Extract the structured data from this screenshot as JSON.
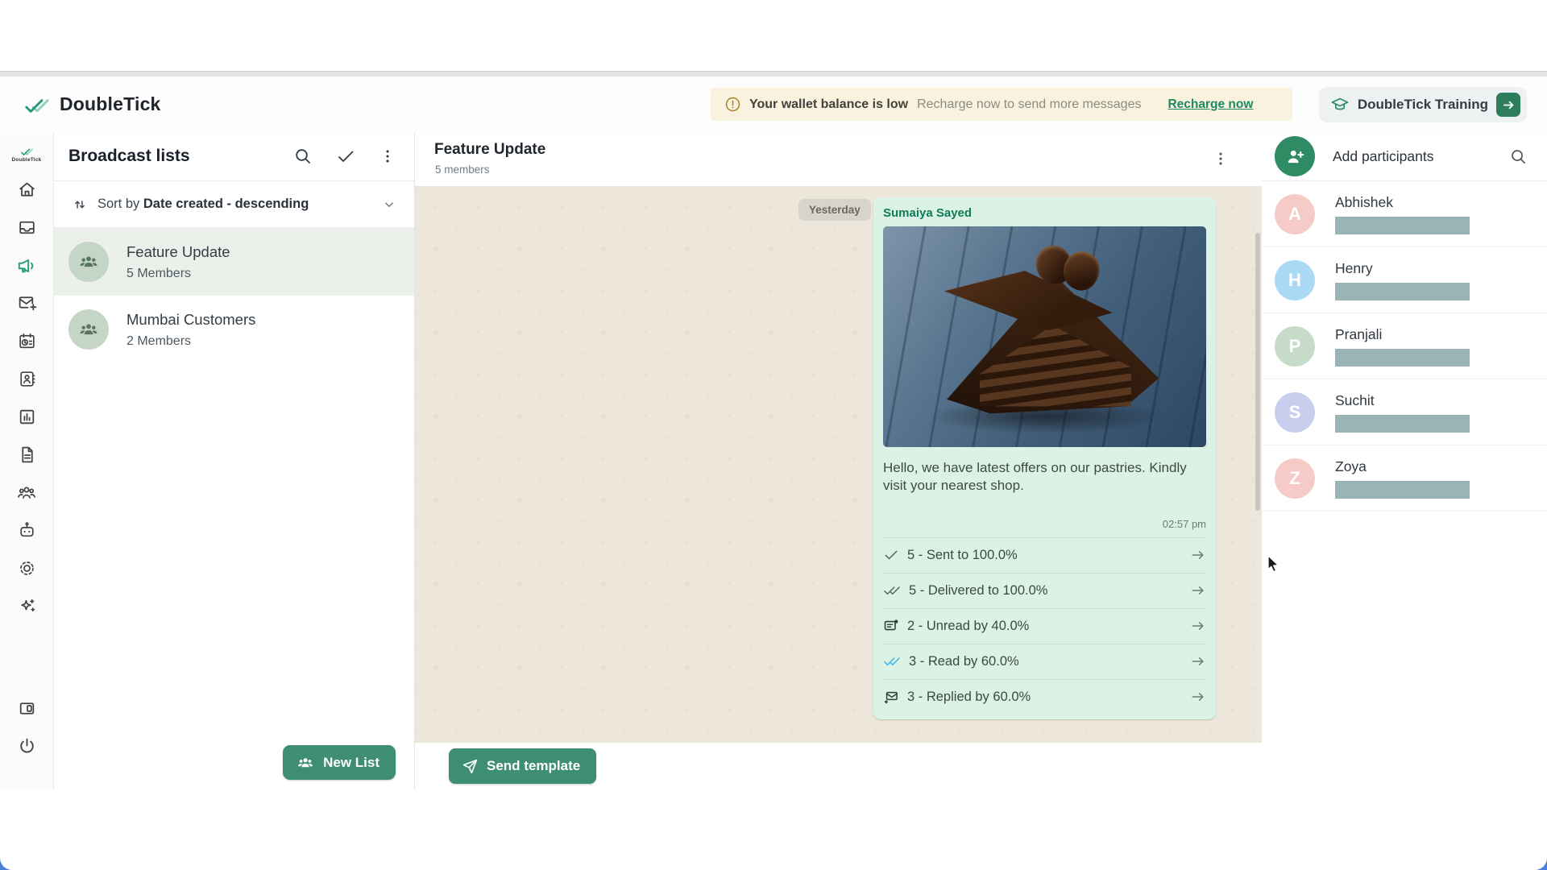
{
  "header": {
    "app_title": "DoubleTick",
    "banner": {
      "bold_text": "Your wallet balance is low",
      "text": "Recharge now to send more messages",
      "link_label": "Recharge now"
    },
    "training_button_label": "DoubleTick Training"
  },
  "sidebar": {
    "logo_label": "DoubleTick",
    "icons": [
      "home",
      "inbox",
      "broadcast",
      "new-message",
      "scheduled",
      "contacts",
      "analytics",
      "templates",
      "team",
      "chatbot",
      "settings",
      "ai-tools",
      "side-panel",
      "logout"
    ],
    "active_icon": "broadcast"
  },
  "broadcast_panel": {
    "title": "Broadcast lists",
    "sort_prefix": "Sort by",
    "sort_value": "Date created - descending",
    "lists": [
      {
        "name": "Feature Update",
        "members": "5 Members"
      },
      {
        "name": "Mumbai Customers",
        "members": "2 Members"
      }
    ],
    "new_list_button": "New List"
  },
  "chat": {
    "title": "Feature Update",
    "subtitle": "5 members",
    "date_chip": "Yesterday",
    "message": {
      "sender": "Sumaiya Sayed",
      "image_alt": "chocolate-cake-photo",
      "text": "Hello, we have latest offers on our pastries. Kindly visit your nearest shop.",
      "time": "02:57 pm",
      "stats": [
        {
          "icon": "sent-check",
          "label": "5 - Sent to 100.0%"
        },
        {
          "icon": "delivered-double-check",
          "label": "5 - Delivered to 100.0%"
        },
        {
          "icon": "unread-message",
          "label": "2 - Unread by 40.0%"
        },
        {
          "icon": "read-blue-double-check",
          "label": "3 - Read by 60.0%"
        },
        {
          "icon": "replied-envelope",
          "label": "3 - Replied by 60.0%"
        }
      ]
    },
    "send_template_button": "Send template"
  },
  "participants_panel": {
    "title": "Add participants",
    "participants": [
      {
        "name": "Abhishek",
        "initial": "A",
        "avatar_color": "#f6cbc7"
      },
      {
        "name": "Henry",
        "initial": "H",
        "avatar_color": "#a9d9f5"
      },
      {
        "name": "Pranjali",
        "initial": "P",
        "avatar_color": "#c6dcc8"
      },
      {
        "name": "Suchit",
        "initial": "S",
        "avatar_color": "#c9cdee"
      },
      {
        "name": "Zoya",
        "initial": "Z",
        "avatar_color": "#f6cbc7"
      }
    ]
  },
  "colors": {
    "primary_green": "#3e8e71",
    "link_green": "#1d8a62",
    "logo_teal": "#21997a",
    "bubble_green": "#daf3e5",
    "wallpaper_beige": "#ece6db",
    "banner_beige": "#f9f2de",
    "selected_list_bg": "#ebf0eb",
    "redacted_bar": "#9cb3b5",
    "read_tick_blue": "#41b6e8"
  }
}
